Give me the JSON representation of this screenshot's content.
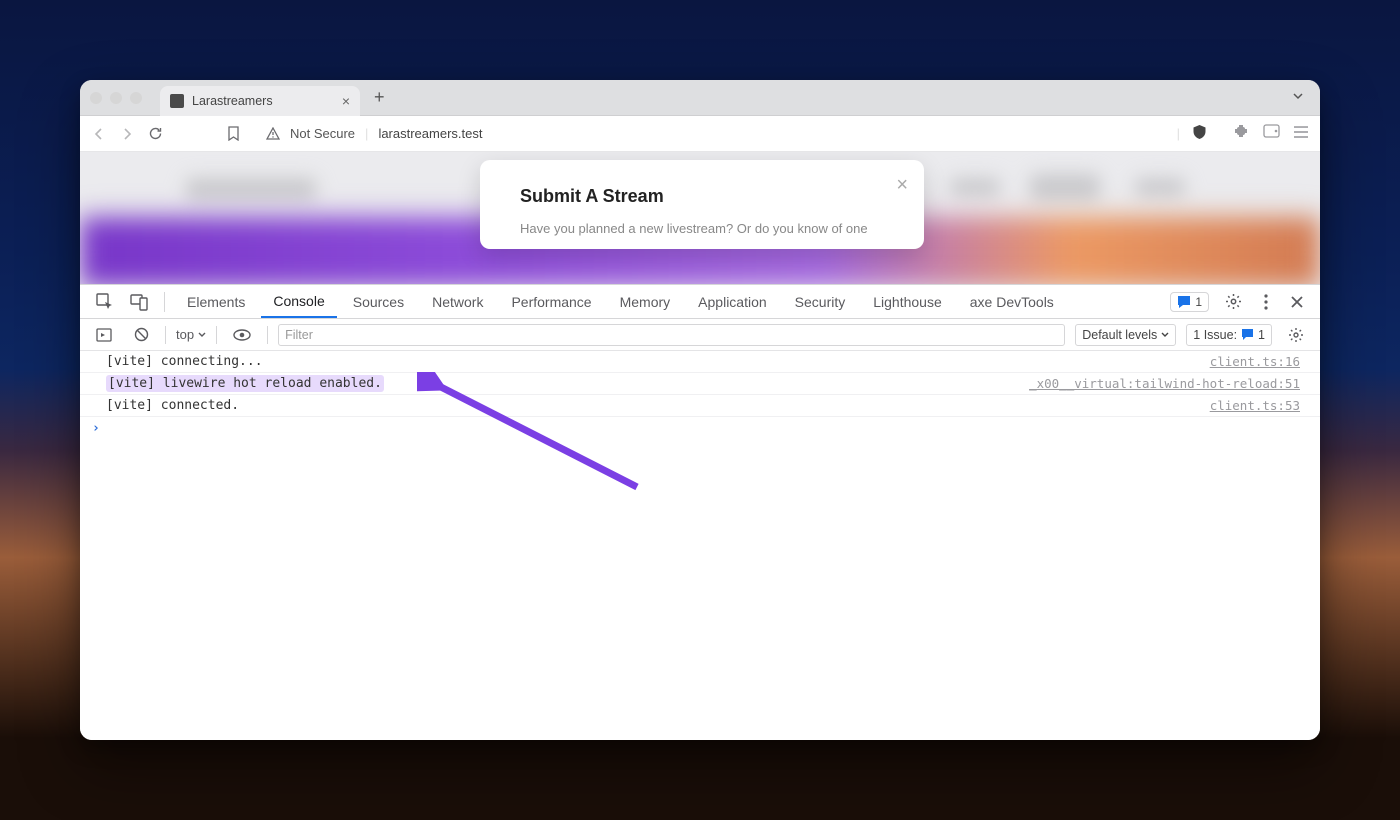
{
  "tab": {
    "title": "Larastreamers"
  },
  "urlbar": {
    "security_label": "Not Secure",
    "url": "larastreamers.test"
  },
  "modal": {
    "title": "Submit A Stream",
    "body": "Have you planned a new livestream? Or do you know of one"
  },
  "devtools": {
    "tabs": [
      "Elements",
      "Console",
      "Sources",
      "Network",
      "Performance",
      "Memory",
      "Application",
      "Security",
      "Lighthouse",
      "axe DevTools"
    ],
    "active_tab": "Console",
    "msg_count": "1",
    "context": "top",
    "filter_placeholder": "Filter",
    "levels_label": "Default levels",
    "issues_label": "1 Issue:",
    "issues_count": "1"
  },
  "console": {
    "rows": [
      {
        "msg": "[vite] connecting...",
        "src": "client.ts:16",
        "hl": false
      },
      {
        "msg": "[vite] livewire hot reload enabled.",
        "src": "_x00__virtual:tailwind-hot-reload:51",
        "hl": true
      },
      {
        "msg": "[vite] connected.",
        "src": "client.ts:53",
        "hl": false
      }
    ]
  }
}
